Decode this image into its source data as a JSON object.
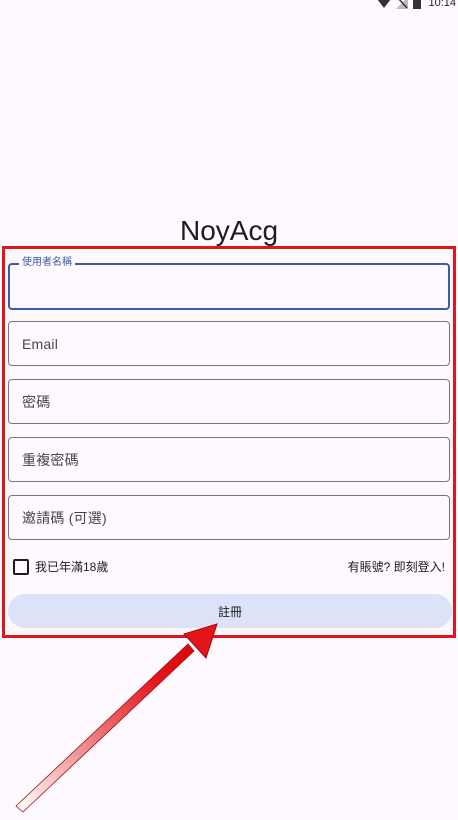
{
  "status_bar": {
    "time": "10:14",
    "icons": [
      "wifi-icon",
      "signal-icon",
      "battery-icon"
    ]
  },
  "app": {
    "title": "NoyAcg"
  },
  "form": {
    "username": {
      "label": "使用者名稱",
      "value": "",
      "focused": true
    },
    "email": {
      "placeholder": "Email",
      "value": ""
    },
    "password": {
      "placeholder": "密碼",
      "value": ""
    },
    "confirm_password": {
      "placeholder": "重複密碼",
      "value": ""
    },
    "invite_code": {
      "placeholder": "邀請碼 (可選)",
      "value": ""
    },
    "age_checkbox": {
      "label": "我已年滿18歲",
      "checked": false
    },
    "login_link": "有賬號? 即刻登入!",
    "register_button": "註冊"
  },
  "colors": {
    "accent": "#3b5ba5",
    "highlight": "#e4141b",
    "button_bg": "#dce2f8",
    "background": "#fdf9ff"
  }
}
